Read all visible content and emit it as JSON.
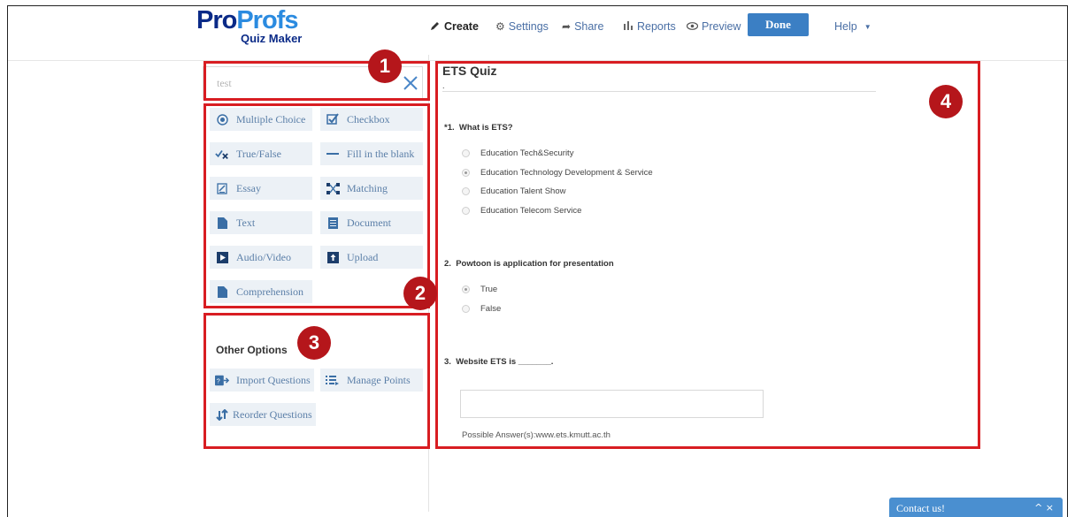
{
  "logo": {
    "part1": "Pro",
    "part2": "Profs",
    "subtitle": "Quiz Maker"
  },
  "nav": {
    "create": "Create",
    "settings": "Settings",
    "share": "Share",
    "reports": "Reports",
    "preview": "Preview",
    "done": "Done",
    "help": "Help"
  },
  "search": {
    "value": "test"
  },
  "question_types": [
    {
      "label": "Multiple Choice",
      "icon": "radio-icon"
    },
    {
      "label": "Checkbox",
      "icon": "checkbox-icon"
    },
    {
      "label": "True/False",
      "icon": "true-false-icon"
    },
    {
      "label": "Fill in the blank",
      "icon": "fill-blank-icon"
    },
    {
      "label": "Essay",
      "icon": "essay-icon"
    },
    {
      "label": "Matching",
      "icon": "matching-icon"
    },
    {
      "label": "Text",
      "icon": "text-icon"
    },
    {
      "label": "Document",
      "icon": "document-icon"
    },
    {
      "label": "Audio/Video",
      "icon": "audio-video-icon"
    },
    {
      "label": "Upload",
      "icon": "upload-icon"
    },
    {
      "label": "Comprehension",
      "icon": "comprehension-icon"
    }
  ],
  "other_options": {
    "title": "Other Options",
    "items": [
      {
        "label": "Import Questions",
        "icon": "import-icon"
      },
      {
        "label": "Manage Points",
        "icon": "manage-points-icon"
      },
      {
        "label": "Reorder Questions",
        "icon": "reorder-icon"
      }
    ]
  },
  "annotations": [
    "1",
    "2",
    "3",
    "4"
  ],
  "quiz": {
    "title": "ETS Quiz",
    "title_dot": ".",
    "questions": [
      {
        "number": "*1.",
        "text": "What is ETS?",
        "options": [
          {
            "label": "Education Tech&Security",
            "selected": false
          },
          {
            "label": "Education Technology Development & Service",
            "selected": true
          },
          {
            "label": "Education Talent Show",
            "selected": false
          },
          {
            "label": "Education Telecom Service",
            "selected": false
          }
        ]
      },
      {
        "number": "2.",
        "text": "Powtoon is application for presentation",
        "options": [
          {
            "label": "True",
            "selected": true
          },
          {
            "label": "False",
            "selected": false
          }
        ]
      },
      {
        "number": "3.",
        "text": "Website ETS is _______.",
        "possible_answers": "Possible Answer(s):www.ets.kmutt.ac.th"
      }
    ]
  },
  "contact": {
    "label": "Contact us!",
    "controls": "^ ×"
  },
  "colors": {
    "accent": "#3b7fc4",
    "annotation": "#d81d22",
    "tile_bg": "#ecf1f6"
  }
}
